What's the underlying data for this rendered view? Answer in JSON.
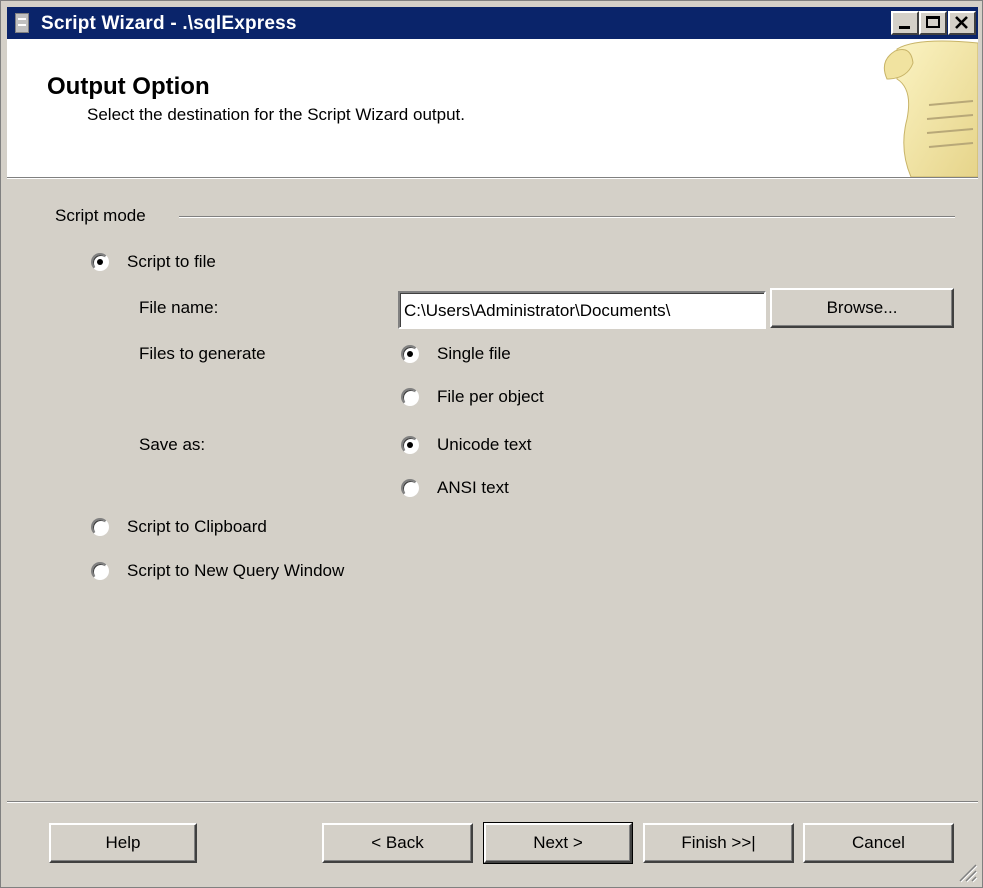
{
  "window": {
    "title": "Script Wizard - .\\sqlExpress"
  },
  "header": {
    "title": "Output Option",
    "subtitle": "Select the destination for the Script Wizard output."
  },
  "script_mode": {
    "group_label": "Script mode",
    "options": {
      "to_file": {
        "label": "Script to file",
        "checked": true
      },
      "to_clipboard": {
        "label": "Script to Clipboard",
        "checked": false
      },
      "to_new_query_window": {
        "label": "Script to New Query Window",
        "checked": false
      }
    },
    "file_name": {
      "label": "File name:",
      "value": "C:\\Users\\Administrator\\Documents\\"
    },
    "browse_label": "Browse...",
    "files_to_generate": {
      "label": "Files to generate",
      "options": {
        "single": {
          "label": "Single file",
          "checked": true
        },
        "per_object": {
          "label": "File per object",
          "checked": false
        }
      }
    },
    "save_as": {
      "label": "Save as:",
      "options": {
        "unicode": {
          "label": "Unicode text",
          "checked": true
        },
        "ansi": {
          "label": "ANSI text",
          "checked": false
        }
      }
    }
  },
  "footer": {
    "help": "Help",
    "back": "< Back",
    "next": "Next >",
    "finish": "Finish >>|",
    "cancel": "Cancel"
  },
  "icons": [
    "app-icon",
    "minimize-icon",
    "maximize-icon",
    "close-icon",
    "scroll-graphic",
    "resize-grip-icon"
  ]
}
